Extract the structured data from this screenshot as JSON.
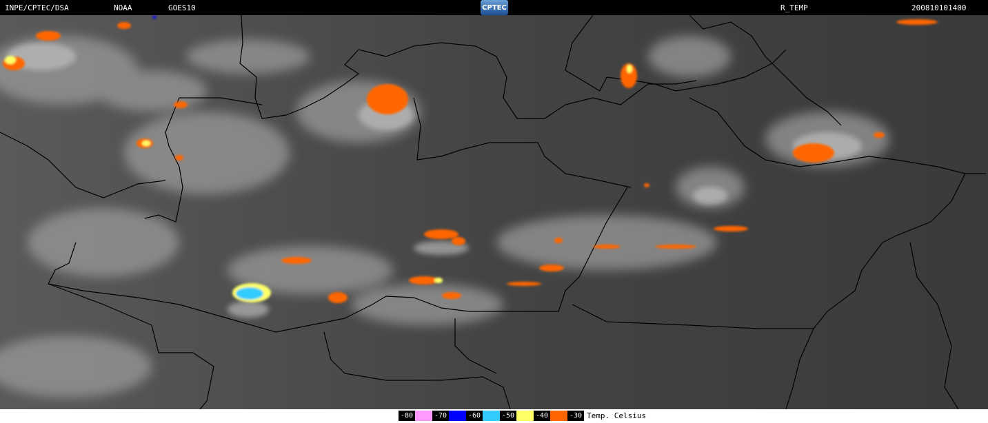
{
  "header": {
    "agency": "INPE/CPTEC/DSA",
    "provider": "NOAA",
    "satellite": "GOES10",
    "logo_text": "CPTEC",
    "product": "R_TEMP",
    "timestamp": "200810101400"
  },
  "legend": {
    "items": [
      {
        "label": "-80",
        "color": "#ff99ff"
      },
      {
        "label": "-70",
        "color": "#0000ff"
      },
      {
        "label": "-60",
        "color": "#33ccff"
      },
      {
        "label": "-50",
        "color": "#ffff66"
      },
      {
        "label": "-40",
        "color": "#ff6600"
      },
      {
        "label": "-30",
        "color": null
      }
    ],
    "unit": "Temp. Celsius"
  }
}
